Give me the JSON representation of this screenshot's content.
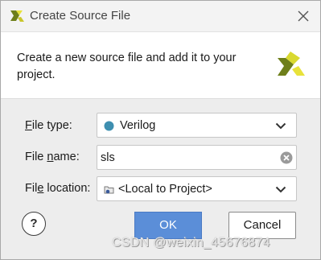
{
  "window": {
    "title": "Create Source File",
    "logo_icon": "xilinx-logo-icon",
    "close_icon": "close-icon"
  },
  "header": {
    "description": "Create a new source file and add it to your project.",
    "logo_icon": "xilinx-logo-icon"
  },
  "form": {
    "file_type": {
      "label_mnemonic": "F",
      "label_rest": "ile type:",
      "value": "Verilog",
      "icon": "verilog-dot-icon",
      "dropdown_icon": "chevron-down-icon"
    },
    "file_name": {
      "label_pre": "File ",
      "label_mnemonic": "n",
      "label_rest": "ame:",
      "value": "sls",
      "clear_icon": "clear-icon"
    },
    "file_location": {
      "label_pre": "Fil",
      "label_mnemonic": "e",
      "label_rest": " location:",
      "value": "<Local to Project>",
      "icon": "folder-icon",
      "dropdown_icon": "chevron-down-icon"
    }
  },
  "buttons": {
    "help": "?",
    "ok": "OK",
    "cancel": "Cancel"
  },
  "watermark": "CSDN @weixin_45676874",
  "colors": {
    "ok_button": "#5b8ed8",
    "logo_green": "#6e7f1a",
    "logo_yellow": "#e8e23a",
    "verilog_dot": "#3e8fb0"
  }
}
